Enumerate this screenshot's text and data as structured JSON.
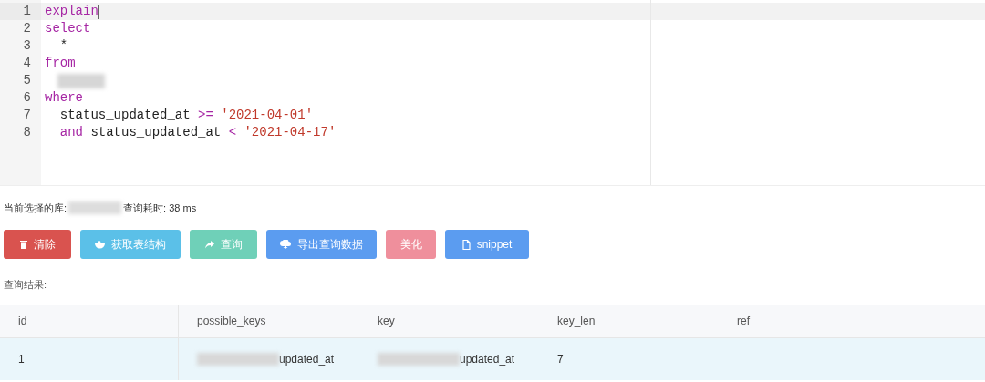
{
  "editor": {
    "lines": [
      {
        "number": "1",
        "tokens": [
          {
            "kind": "keyword",
            "text": "explain"
          }
        ],
        "active": true
      },
      {
        "number": "2",
        "tokens": [
          {
            "kind": "keyword",
            "text": "select"
          }
        ],
        "active": false
      },
      {
        "number": "3",
        "tokens": [
          {
            "kind": "plain",
            "text": "  *"
          }
        ],
        "active": false
      },
      {
        "number": "4",
        "tokens": [
          {
            "kind": "keyword",
            "text": "from"
          }
        ],
        "active": false
      },
      {
        "number": "5",
        "tokens": [
          {
            "kind": "redacted"
          }
        ],
        "active": false
      },
      {
        "number": "6",
        "tokens": [
          {
            "kind": "keyword",
            "text": "where"
          }
        ],
        "active": false
      },
      {
        "number": "7",
        "tokens": [
          {
            "kind": "plain",
            "text": "  status_updated_at "
          },
          {
            "kind": "operator",
            "text": ">="
          },
          {
            "kind": "string",
            "text": " '2021-04-01'"
          }
        ],
        "active": false
      },
      {
        "number": "8",
        "tokens": [
          {
            "kind": "keyword",
            "text": "  and"
          },
          {
            "kind": "plain",
            "text": " status_updated_at "
          },
          {
            "kind": "operator",
            "text": "<"
          },
          {
            "kind": "string",
            "text": " '2021-04-17'"
          }
        ],
        "active": false
      }
    ]
  },
  "status": {
    "db_label": "当前选择的库:",
    "time_label": "查询耗时: 38 ms"
  },
  "buttons": [
    {
      "label": "清除",
      "color": "#d9534f"
    },
    {
      "label": "获取表结构",
      "color": "#5bc0e8"
    },
    {
      "label": "查询",
      "color": "#6fd0b8"
    },
    {
      "label": "导出查询数据",
      "color": "#5b9cf0"
    },
    {
      "label": "美化",
      "color": "#ef8f9c"
    },
    {
      "label": "snippet",
      "color": "#5b9cf0"
    }
  ],
  "results_label": "查询结果:",
  "table": {
    "columns": [
      "id",
      "possible_keys",
      "key",
      "key_len",
      "ref"
    ],
    "rows": [
      [
        {
          "text": "1"
        },
        {
          "text": "updated_at",
          "redacted_prefix": true
        },
        {
          "text": "updated_at",
          "redacted_prefix": true
        },
        {
          "text": "7"
        },
        {}
      ]
    ]
  }
}
